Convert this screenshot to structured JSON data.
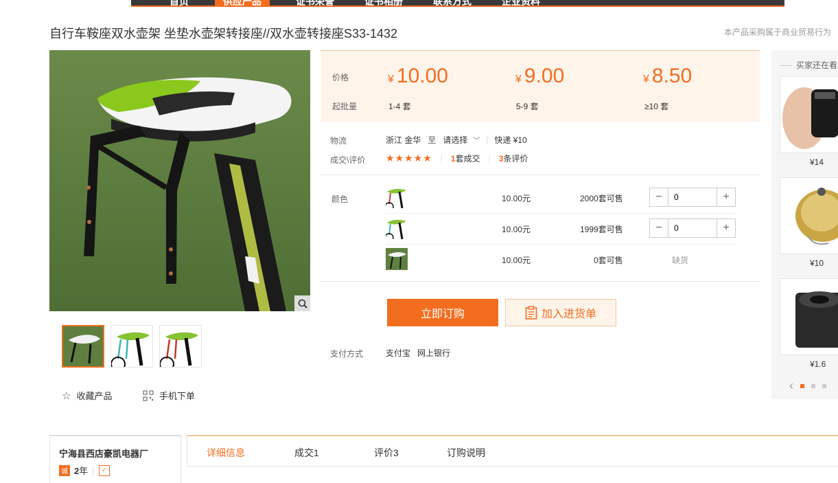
{
  "nav": {
    "items": [
      "首页",
      "供应产品",
      "证书荣誉",
      "证书相册",
      "联系方式",
      "企业资料"
    ]
  },
  "product": {
    "title": "自行车鞍座双水壶架 坐垫水壶架转接座//双水壶转接座S33-1432",
    "trade_note": "本产品采购属于商业贸易行为"
  },
  "price_box": {
    "price_label": "价格",
    "moq_label": "起批量",
    "currency": "¥",
    "tiers": [
      {
        "price": "10.00",
        "qty": "1-4 套"
      },
      {
        "price": "9.00",
        "qty": "5-9 套"
      },
      {
        "price": "8.50",
        "qty": "≥10 套"
      }
    ]
  },
  "logistics": {
    "label": "物流",
    "from": "浙江 金华",
    "to_word": "至",
    "select": "请选择",
    "express": "快递 ¥10"
  },
  "deal": {
    "label": "成交\\评价",
    "stars": "★★★★★",
    "deals_count": "1",
    "deals_text": "套成交",
    "reviews_count": "3",
    "reviews_text": "条评价"
  },
  "color": {
    "label": "颜色",
    "skus": [
      {
        "price": "10.00元",
        "stock": "2000套可售",
        "qty": "0",
        "swatch": "#c0392b"
      },
      {
        "price": "10.00元",
        "stock": "1999套可售",
        "qty": "0",
        "swatch": "#3cb4b4"
      },
      {
        "price": "10.00元",
        "stock": "0套可售",
        "status": "缺货",
        "swatch": "#86c232"
      }
    ]
  },
  "actions": {
    "buy": "立即订购",
    "cart": "加入进货单"
  },
  "payment": {
    "label": "支付方式",
    "methods": [
      "支付宝",
      "网上银行"
    ]
  },
  "gallery": {
    "fav": "收藏产品",
    "mobile": "手机下单"
  },
  "side": {
    "title": "买家还在看",
    "items": [
      {
        "price": "¥14"
      },
      {
        "price": "¥10"
      },
      {
        "price": "¥1.6"
      }
    ]
  },
  "company": {
    "name": "宁海县西店豪凯电器厂",
    "years": "2",
    "years_unit": "年"
  },
  "tabs": [
    "详细信息",
    "成交1",
    "评价3",
    "订购说明"
  ],
  "colors": {
    "accent": "#f36d1f",
    "price_bg": "#fff4ea"
  }
}
